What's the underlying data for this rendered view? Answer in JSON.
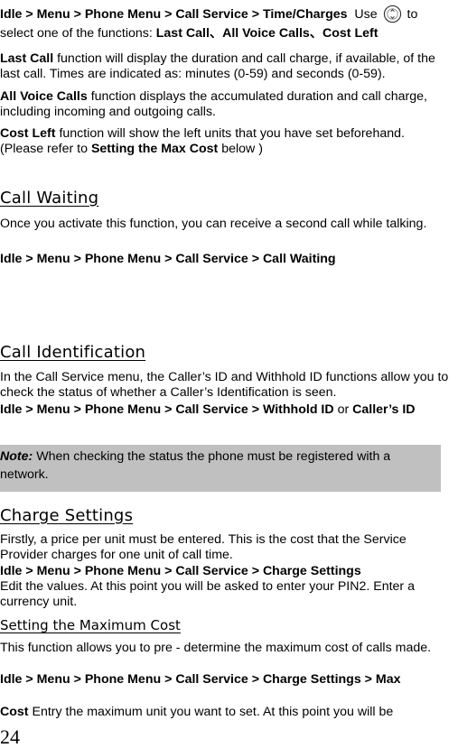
{
  "time_charges": {
    "path": "Idle > Menu > Phone Menu > Call Service > Time/Charges",
    "use_text_before": "Use",
    "icon": "nav-key-icon",
    "use_text_after": "to",
    "select_text": "select one of the functions:",
    "functions": "Last Call、All Voice Calls、Cost Left",
    "last_call": {
      "term": "Last Call",
      "text": "function will display the duration and call charge, if available, of the last call. Times are indicated as: minutes (0-59) and seconds (0-59)."
    },
    "all_voice_calls": {
      "term": "All Voice Calls",
      "text": "function displays the accumulated duration and call charge, including incoming and outgoing calls."
    },
    "cost_left": {
      "term": "Cost Left",
      "text": "function will show the left units that you have set beforehand.",
      "refer_prefix": "(Please refer to",
      "refer_bold": "Setting the Max Cost",
      "refer_suffix": "below )"
    }
  },
  "call_waiting": {
    "heading": "Call Waiting",
    "text": "Once you activate this function, you can receive a second call while talking.",
    "path": "Idle > Menu > Phone Menu > Call Service > Call Waiting"
  },
  "call_identification": {
    "heading": "Call Identification",
    "text": "In the Call Service menu, the Caller’s ID and Withhold ID functions allow you to check the status of whether a Caller’s Identification is seen.",
    "path": "Idle > Menu > Phone Menu > Call Service > Withhold ID",
    "or": "or",
    "path_alt": "Caller’s ID",
    "note_label": "Note:",
    "note_text": "When checking the status the phone must be registered with a network."
  },
  "charge_settings": {
    "heading": "Charge Settings",
    "text": "Firstly, a price per unit must be entered. This is the cost that the Service Provider charges for one unit of call time.",
    "path": "Idle > Menu > Phone Menu > Call Service > Charge Settings",
    "text2": "Edit the values. At this point you will be asked to enter your PIN2.  Enter a currency unit."
  },
  "max_cost": {
    "heading": "Setting the Maximum Cost",
    "text": "This function allows you to pre - determine the maximum cost of calls made.",
    "path": "Idle > Menu > Phone Menu > Call Service > Charge Settings > Max",
    "cost_bold": "Cost",
    "cost_text": "Entry the maximum unit you want to set. At this point you will be"
  },
  "page_number": "24"
}
